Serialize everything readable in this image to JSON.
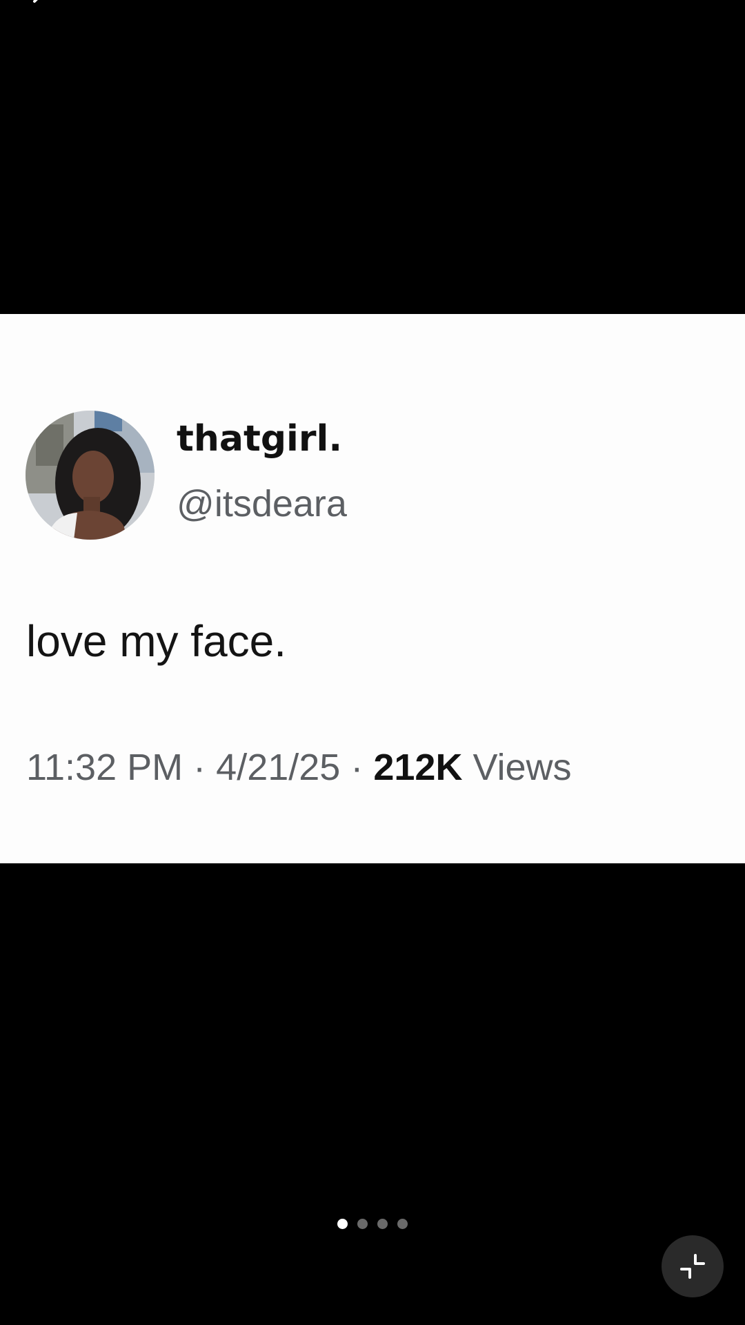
{
  "tweet": {
    "display_name": "thatgirl.",
    "handle": "@itsdeara",
    "text": "love my face.",
    "time": "11:32 PM",
    "separator": "·",
    "date": "4/21/25",
    "views_count": "212K",
    "views_label": "Views"
  },
  "pager": {
    "total": 4,
    "current": 1
  },
  "icons": {
    "back": "chevron-left-icon",
    "collapse": "collapse-icon",
    "avatar": "avatar"
  },
  "colors": {
    "background": "#000000",
    "card": "#fdfdfd",
    "primary_text": "#111111",
    "secondary_text": "#5c5f63",
    "dot_active": "#ffffff",
    "dot_inactive": "#6a6a6a"
  }
}
